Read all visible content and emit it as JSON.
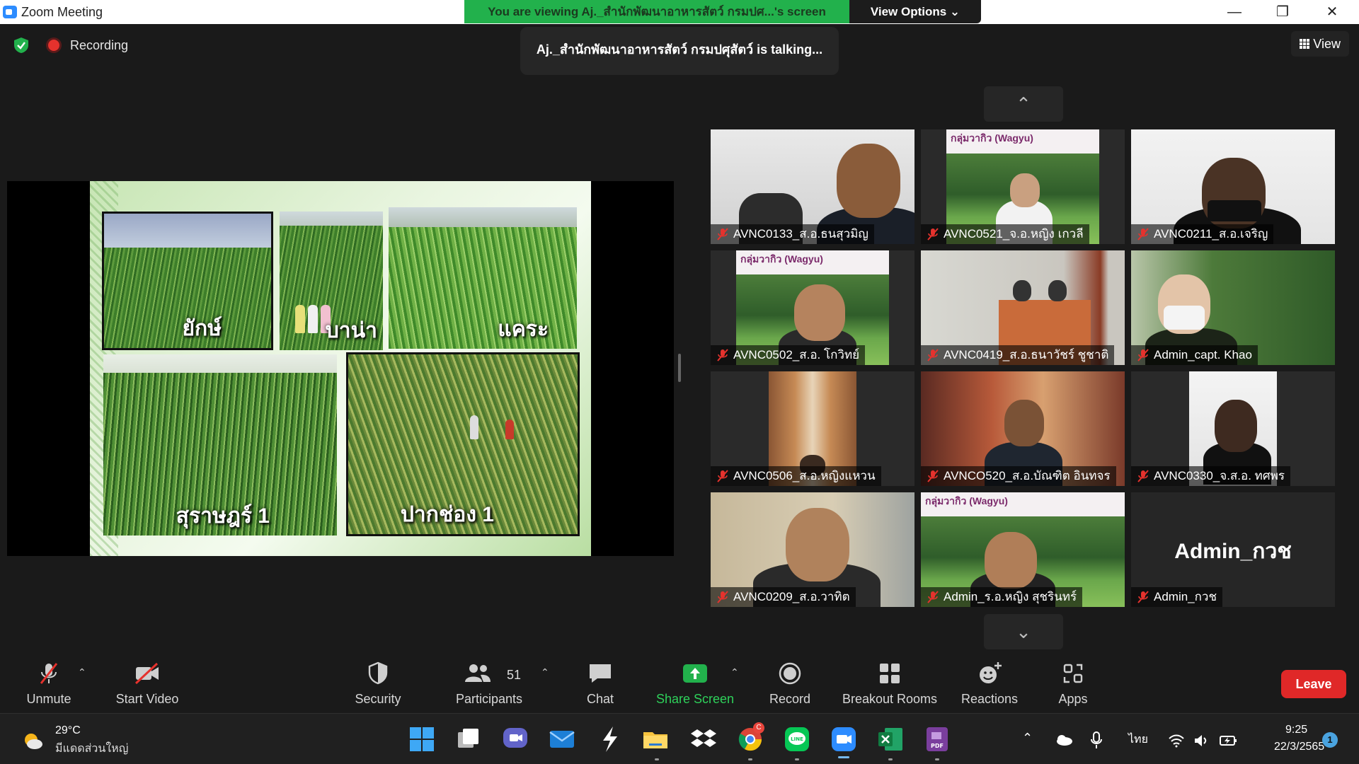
{
  "window": {
    "title": "Zoom Meeting",
    "viewing_banner": "You are viewing Aj._สำนักพัฒนาอาหารสัตว์ กรมปศ...'s screen",
    "view_options": "View Options ⌄"
  },
  "status": {
    "recording": "Recording",
    "talking": "Aj._สำนักพัฒนาอาหารสัตว์ กรมปศุสัตว์ is talking...",
    "view": "View"
  },
  "slide": {
    "captions": [
      "ยักษ์",
      "บาน่า",
      "แคระ",
      "สุราษฎร์ 1",
      "ปากช่อง 1"
    ]
  },
  "gallery": {
    "tiles": [
      {
        "name": "AVNC0133_ส.อ.ธนสุวมิญ"
      },
      {
        "name": "AVNC0521_จ.อ.หญิง เกวลี",
        "banner": "กลุ่มวากิว (Wagyu)"
      },
      {
        "name": "AVNC0211_ส.อ.เจริญ"
      },
      {
        "name": "AVNC0502_ส.อ. โกวิทย์",
        "banner": "กลุ่มวากิว (Wagyu)"
      },
      {
        "name": "AVNC0419_ส.อ.ธนาวัชร์ ชูชาติ"
      },
      {
        "name": "Admin_capt. Khao"
      },
      {
        "name": "AVNC0506_ส.อ.หญิงแหวน"
      },
      {
        "name": "AVNCO520_ส.อ.บัณฑิต อินทจร"
      },
      {
        "name": "AVNC0330_จ.ส.อ. ทศพร"
      },
      {
        "name": "AVNC0209_ส.อ.วาทิต"
      },
      {
        "name": "Admin_ร.อ.หญิง สุชรินทร์",
        "banner": "กลุ่มวากิว (Wagyu)"
      },
      {
        "name": "Admin_กวช",
        "big": "Admin_กวช"
      }
    ]
  },
  "toolbar": {
    "unmute": "Unmute",
    "start_video": "Start Video",
    "security": "Security",
    "participants": "Participants",
    "participants_count": "51",
    "chat": "Chat",
    "share_screen": "Share Screen",
    "record": "Record",
    "breakout": "Breakout Rooms",
    "reactions": "Reactions",
    "apps": "Apps",
    "leave": "Leave"
  },
  "taskbar": {
    "temperature": "29°C",
    "weather": "มีแดดส่วนใหญ่",
    "language": "ไทย",
    "time": "9:25",
    "date": "22/3/2565",
    "notifications": "1",
    "chrome_badge": "C"
  },
  "colors": {
    "banner_green": "#22b14c",
    "leave_red": "#e02828",
    "share_green": "#22b14c",
    "mute_red": "#e5322d"
  }
}
